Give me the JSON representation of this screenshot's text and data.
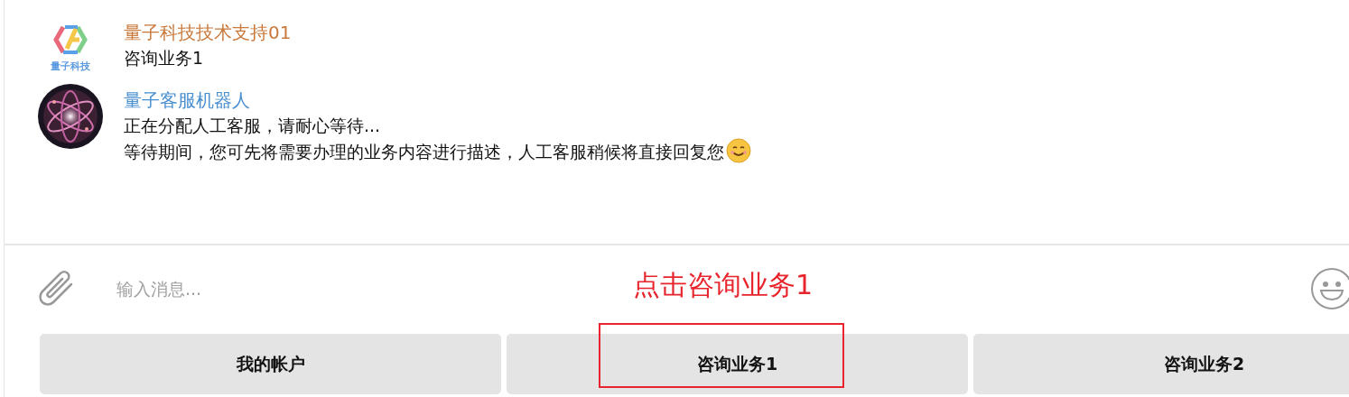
{
  "messages": [
    {
      "avatar": {
        "kind": "logo",
        "label": "量子科技"
      },
      "sender": "量子科技技术支持01",
      "color": "#c9783a",
      "lines": [
        "咨询业务1"
      ]
    },
    {
      "avatar": {
        "kind": "picture"
      },
      "sender": "量子客服机器人",
      "color": "#4a8fd0",
      "lines": [
        "正在分配人工客服，请耐心等待...",
        "等待期间，您可先将需要办理的业务内容进行描述，人工客服稍候将直接回复您"
      ],
      "ends_with_emoji": true
    }
  ],
  "input": {
    "placeholder": "输入消息..."
  },
  "quick_buttons": [
    {
      "label": "我的帐户",
      "highlighted": false
    },
    {
      "label": "咨询业务1",
      "highlighted": true
    },
    {
      "label": "咨询业务2",
      "highlighted": false
    }
  ],
  "annotation": {
    "text": "点击咨询业务1"
  }
}
